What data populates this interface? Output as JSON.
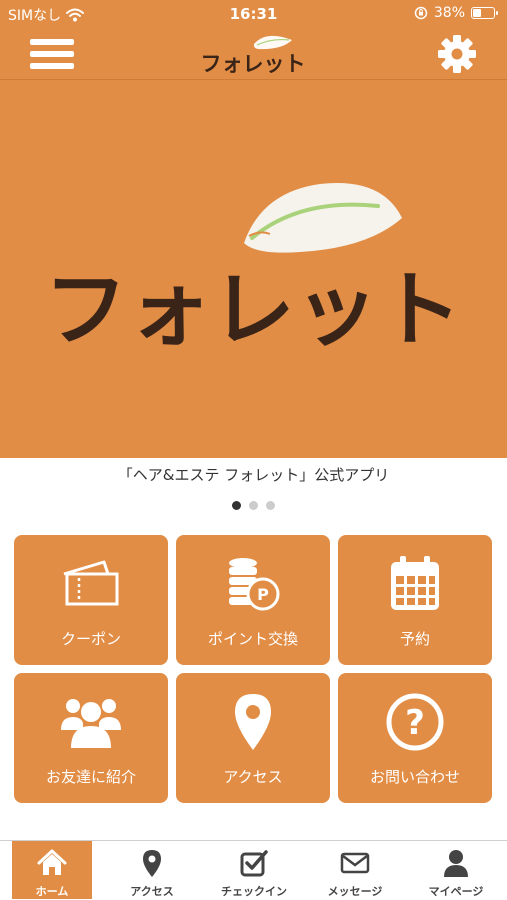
{
  "status_bar": {
    "carrier": "SIMなし",
    "time": "16:31",
    "battery_percent": "38%",
    "battery_level": 0.38
  },
  "header": {
    "menu_icon": "hamburger-menu-icon",
    "settings_icon": "gear-icon",
    "logo_text": "フォレット"
  },
  "hero": {
    "logo_text": "フォレット",
    "caption": "「ヘア&エステ フォレット」公式アプリ",
    "slide_count": 3,
    "active_slide": 1
  },
  "menu_tiles": [
    {
      "label": "クーポン",
      "icon": "ticket-icon"
    },
    {
      "label": "ポイント交換",
      "icon": "coins-icon"
    },
    {
      "label": "予約",
      "icon": "calendar-icon"
    },
    {
      "label": "お友達に紹介",
      "icon": "group-icon"
    },
    {
      "label": "アクセス",
      "icon": "map-pin-icon"
    },
    {
      "label": "お問い合わせ",
      "icon": "question-icon"
    }
  ],
  "tab_bar": [
    {
      "label": "ホーム",
      "icon": "home-icon",
      "active": true
    },
    {
      "label": "アクセス",
      "icon": "map-pin-icon",
      "active": false
    },
    {
      "label": "チェックイン",
      "icon": "checkin-icon",
      "active": false
    },
    {
      "label": "メッセージ",
      "icon": "envelope-icon",
      "active": false
    },
    {
      "label": "マイページ",
      "icon": "user-icon",
      "active": false
    }
  ],
  "colors": {
    "brand_orange": "#E28D45",
    "logo_brown": "#3A2418",
    "leaf_green": "#A9D27A"
  }
}
